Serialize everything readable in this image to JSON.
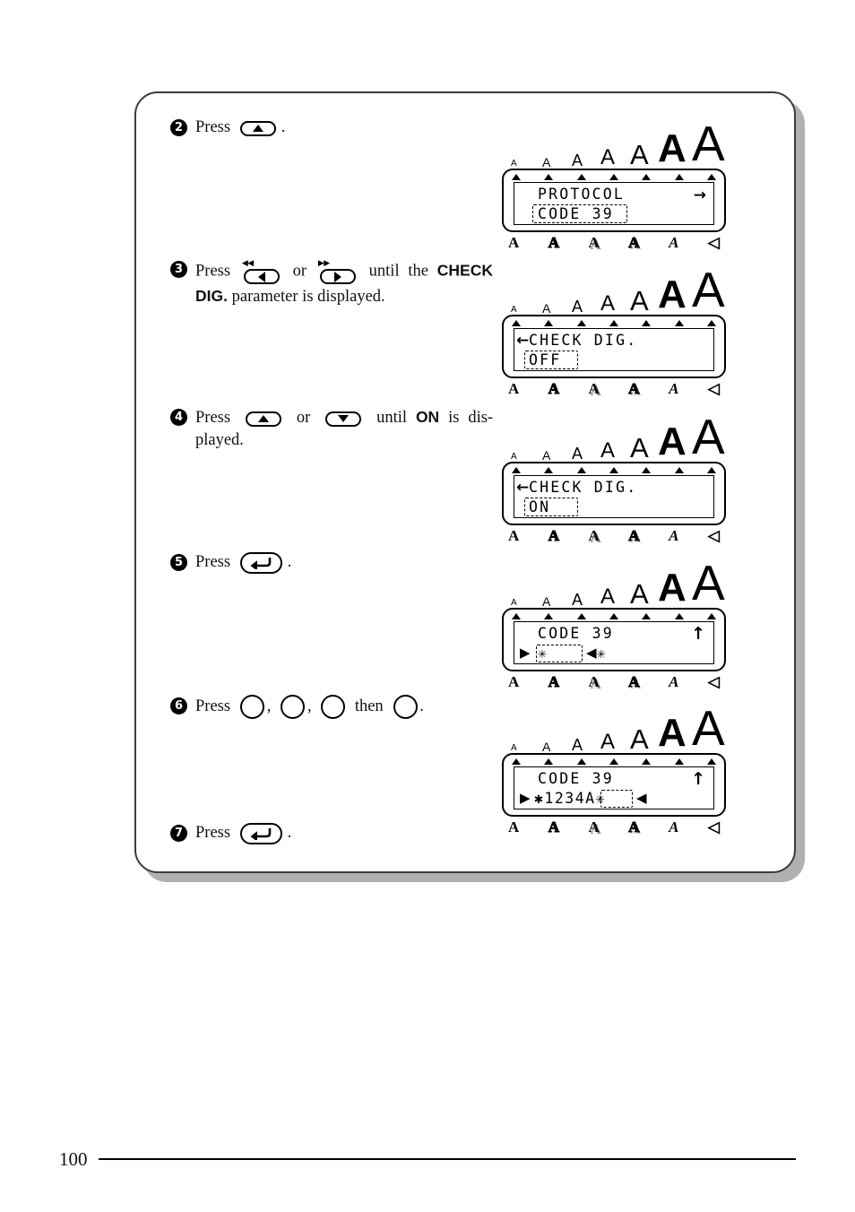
{
  "page": {
    "number": "100"
  },
  "steps": [
    {
      "num": "2",
      "text_before": "Press",
      "text_after": ".",
      "keys": [
        "up-arrow-key"
      ]
    },
    {
      "num": "3",
      "text_before": "Press",
      "text_mid": "or",
      "text_after_1": "until the",
      "bold_1": "CHECK DIG.",
      "text_after_2": "parameter is displayed.",
      "keys": [
        "left-arrow-key",
        "right-arrow-key"
      ]
    },
    {
      "num": "4",
      "text_before": "Press",
      "text_mid": "or",
      "text_after_1": "until",
      "bold_1": "ON",
      "text_after_2": "is dis-played.",
      "keys": [
        "up-arrow-key",
        "down-arrow-key"
      ]
    },
    {
      "num": "5",
      "text_before": "Press",
      "text_after": ".",
      "keys": [
        "enter-key"
      ]
    },
    {
      "num": "6",
      "text_before": "Press",
      "sep_1": ",",
      "sep_2": ",",
      "text_mid": "then",
      "text_after": ".",
      "keys": [
        "blank-key",
        "blank-key",
        "blank-key",
        "blank-key"
      ]
    },
    {
      "num": "7",
      "text_before": "Press",
      "text_after": ".",
      "keys": [
        "enter-key"
      ]
    }
  ],
  "step3_labels": {
    "left_key_mini": "◀◀",
    "right_key_mini": "▶▶"
  },
  "displays": [
    {
      "id": "display-protocol",
      "line1": "PROTOCOL",
      "line2": "CODE 39",
      "right_glyph": "→",
      "left_glyph": "",
      "blink_target": "line2"
    },
    {
      "id": "display-check-dig-off",
      "line1": "CHECK DIG.",
      "line2": "OFF",
      "right_glyph": "",
      "left_glyph": "←",
      "blink_target": "line2"
    },
    {
      "id": "display-check-dig-on",
      "line1": "CHECK DIG.",
      "line2": "ON",
      "right_glyph": "",
      "left_glyph": "←",
      "blink_target": "line2"
    },
    {
      "id": "display-code39-empty",
      "line1": "CODE 39",
      "line2": "✳  ✳",
      "right_glyph": "↑",
      "left_glyph": "",
      "blink_target": "line2"
    },
    {
      "id": "display-code39-1234a",
      "line1": "CODE 39",
      "line2": "✱1234A✳",
      "right_glyph": "↑",
      "left_glyph": "",
      "blink_target": "line2"
    }
  ],
  "lcd": {
    "size_scale_letters": [
      "A",
      "A",
      "A",
      "A",
      "A",
      "A",
      "A"
    ],
    "marker_count": 7,
    "bottom_icons": [
      {
        "name": "font-normal-icon",
        "glyph": "A",
        "style": "bold"
      },
      {
        "name": "font-outline-icon",
        "glyph": "A",
        "style": "outline"
      },
      {
        "name": "font-shadow-icon",
        "glyph": "A",
        "style": "shadow"
      },
      {
        "name": "font-outline-shadow-icon",
        "glyph": "A",
        "style": "outline-shadow"
      },
      {
        "name": "font-italic-icon",
        "glyph": "A",
        "style": "italic"
      },
      {
        "name": "alignment-icon",
        "glyph": "◁",
        "style": "tri"
      }
    ]
  },
  "colors": {
    "ink": "#000000",
    "frame": "#3c3c3c",
    "shadow": "#b0b0b0",
    "paper": "#ffffff"
  }
}
